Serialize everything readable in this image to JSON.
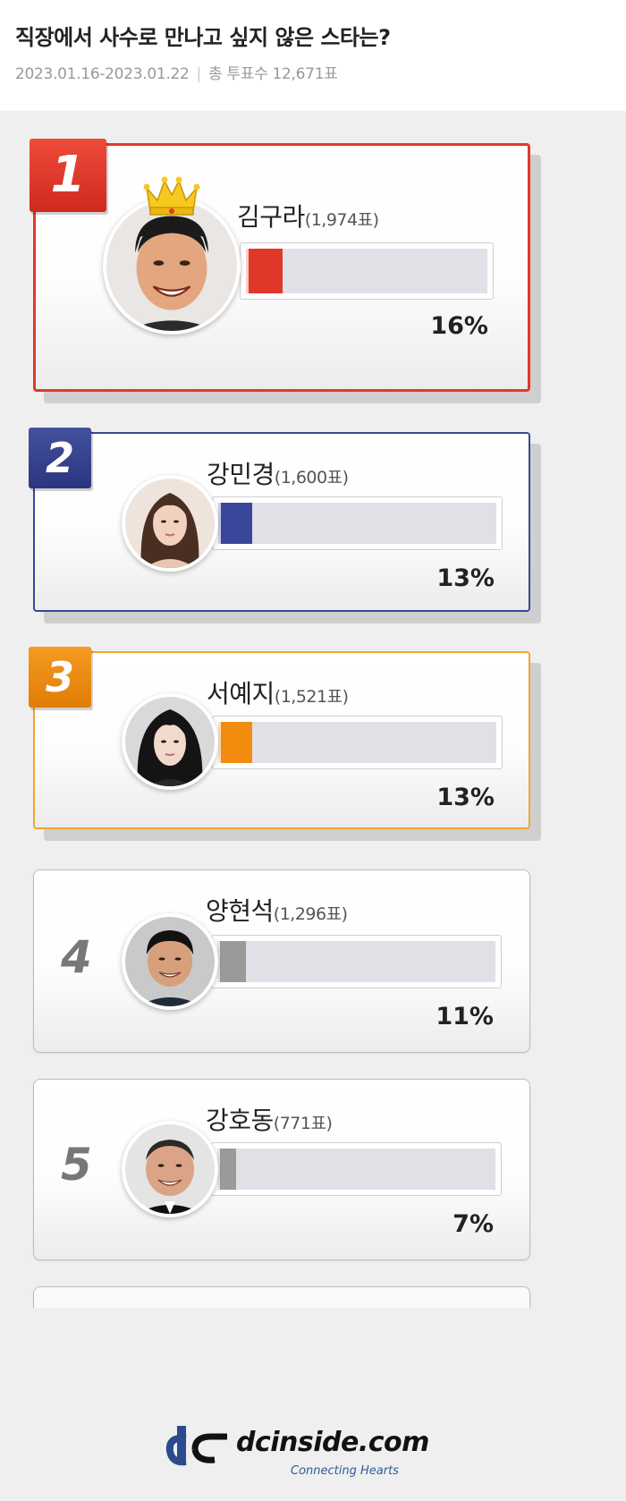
{
  "poll": {
    "title": "직장에서 사수로 만나고 싶지 않은 스타는?",
    "period": "2023.01.16-2023.01.22",
    "total_label": "총 투표수 12,671표"
  },
  "entries": [
    {
      "rank": "1",
      "name": "김구라",
      "votes": "(1,974표)",
      "percent": "16%",
      "fraction": 0.16,
      "color": "#e2382a"
    },
    {
      "rank": "2",
      "name": "강민경",
      "votes": "(1,600표)",
      "percent": "13%",
      "fraction": 0.13,
      "color": "#3a4699"
    },
    {
      "rank": "3",
      "name": "서예지",
      "votes": "(1,521표)",
      "percent": "13%",
      "fraction": 0.13,
      "color": "#f28c0f"
    },
    {
      "rank": "4",
      "name": "양현석",
      "votes": "(1,296표)",
      "percent": "11%",
      "fraction": 0.11,
      "color": "#9a9a9a"
    },
    {
      "rank": "5",
      "name": "강호동",
      "votes": "(771표)",
      "percent": "7%",
      "fraction": 0.07,
      "color": "#9a9a9a"
    }
  ],
  "brand": {
    "name": "dcinside.com",
    "slogan": "Connecting Hearts"
  },
  "icons": [
    "crown-icon",
    "dcinside-logo-icon"
  ]
}
